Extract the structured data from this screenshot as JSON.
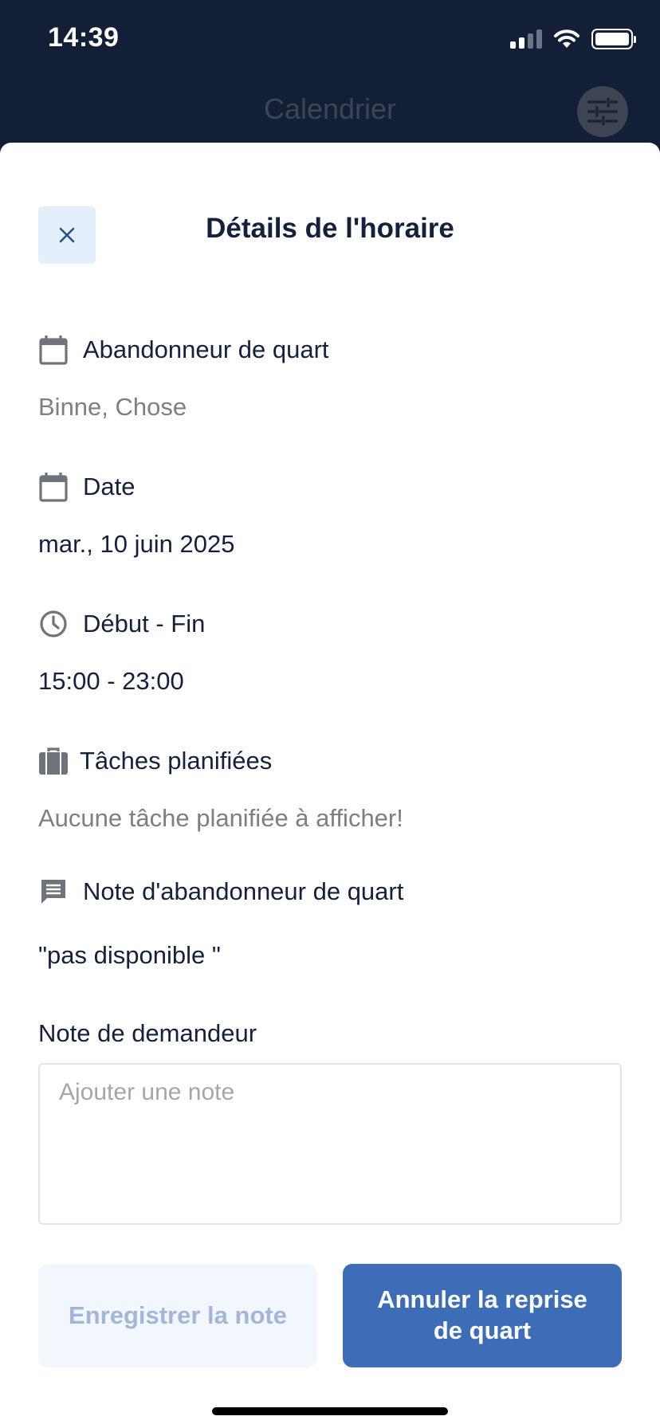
{
  "status_bar": {
    "time": "14:39"
  },
  "header": {
    "title": "Calendrier",
    "filter_icon": "sliders-icon"
  },
  "sheet": {
    "title": "Détails de l'horaire",
    "close_icon": "close-icon",
    "sections": {
      "abandoner": {
        "label": "Abandonneur de quart",
        "value": "Binne, Chose",
        "icon": "calendar-icon"
      },
      "date": {
        "label": "Date",
        "value": "mar., 10 juin 2025",
        "icon": "calendar-icon"
      },
      "time": {
        "label": "Début - Fin",
        "value": "15:00 - 23:00",
        "icon": "clock-icon"
      },
      "tasks": {
        "label": "Tâches planifiées",
        "value": "Aucune tâche planifiée à afficher!",
        "icon": "briefcase-icon"
      },
      "abandoner_note": {
        "label": "Note d'abandonneur de quart",
        "value": "\"pas disponible \"",
        "icon": "message-icon"
      }
    },
    "requester_note": {
      "label": "Note de demandeur",
      "placeholder": "Ajouter une note"
    },
    "buttons": {
      "save": "Enregistrer la note",
      "cancel": "Annuler la reprise de quart"
    }
  },
  "colors": {
    "header_bg": "#131f36",
    "primary": "#3e6db8",
    "text": "#14213d",
    "muted": "#7b7f86"
  }
}
